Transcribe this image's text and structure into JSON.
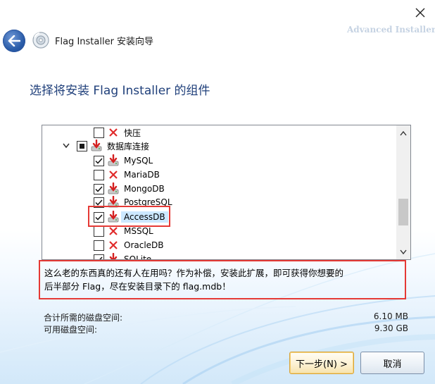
{
  "window": {
    "title": "Flag Installer 安装向导",
    "brand": "Advanced Installer"
  },
  "page": {
    "heading": "选择将安装 Flag Installer 的组件"
  },
  "tree": {
    "items": [
      {
        "label": "快压",
        "checked": false
      },
      {
        "label": "数据库连接",
        "state": "partial"
      },
      {
        "label": "MySQL",
        "checked": true
      },
      {
        "label": "MariaDB",
        "checked": false
      },
      {
        "label": "MongoDB",
        "checked": true
      },
      {
        "label": "PostgreSQL",
        "checked": true
      },
      {
        "label": "AccessDB",
        "checked": true
      },
      {
        "label": "MSSQL",
        "checked": false
      },
      {
        "label": "OracleDB",
        "checked": false
      },
      {
        "label": "SQLite",
        "checked": true
      }
    ],
    "selected": "AccessDB"
  },
  "description": {
    "line1": "这么老的东西真的还有人在用吗？作为补偿，安装此扩展，即可获得你想要的",
    "line2": "后半部分 Flag，尽在安装目录下的 flag.mdb！"
  },
  "space": {
    "required_label": "合计所需的磁盘空间:",
    "required_value": "6.10 MB",
    "available_label": "可用磁盘空间:",
    "available_value": "9.30 GB"
  },
  "buttons": {
    "next": "下一步(N) >",
    "cancel": "取消"
  },
  "colors": {
    "heading": "#1f3f7a",
    "highlight": "#e53935",
    "selection": "#cce8ff"
  }
}
